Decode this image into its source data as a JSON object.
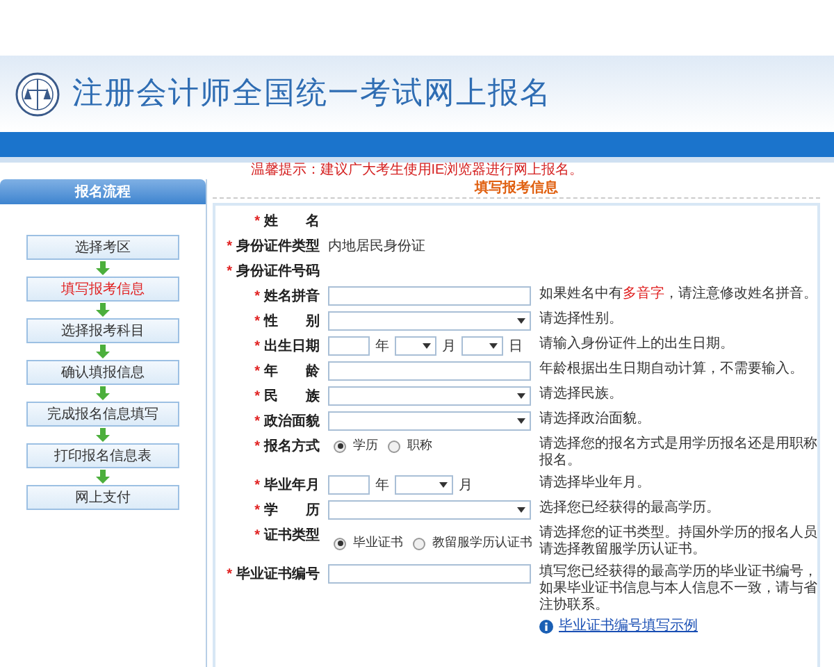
{
  "header": {
    "title": "注册会计师全国统一考试网上报名"
  },
  "notice": "温馨提示：建议广大考生使用IE浏览器进行网上报名。",
  "sidebar": {
    "title": "报名流程",
    "steps": [
      {
        "label": "选择考区",
        "selected": false
      },
      {
        "label": "填写报考信息",
        "selected": true
      },
      {
        "label": "选择报考科目",
        "selected": false
      },
      {
        "label": "确认填报信息",
        "selected": false
      },
      {
        "label": "完成报名信息填写",
        "selected": false
      },
      {
        "label": "打印报名信息表",
        "selected": false
      },
      {
        "label": "网上支付",
        "selected": false
      }
    ]
  },
  "form": {
    "title": "填写报考信息",
    "rows": [
      {
        "kind": "blank",
        "mark": "*",
        "label": "姓　　名"
      },
      {
        "kind": "text",
        "mark": "*",
        "label": "身份证件类型",
        "value": "内地居民身份证"
      },
      {
        "kind": "blank",
        "mark": "*",
        "label": "身份证件号码"
      },
      {
        "kind": "input",
        "mark": "*",
        "label": "姓名拼音",
        "hint": [
          {
            "text": "如果姓名中有",
            "highlight": false
          },
          {
            "text": "多音字",
            "highlight": true
          },
          {
            "text": "，请注意修改姓名拼音。",
            "highlight": false
          }
        ]
      },
      {
        "kind": "select",
        "mark": "*",
        "label": "性　　别",
        "hint": [
          {
            "text": "请选择性别。",
            "highlight": false
          }
        ]
      },
      {
        "kind": "date",
        "mark": "*",
        "label": "出生日期",
        "units": [
          "年",
          "月",
          "日"
        ],
        "hint": [
          {
            "text": "请输入身份证件上的出生日期。",
            "highlight": false
          }
        ]
      },
      {
        "kind": "input",
        "mark": "*",
        "label": "年　　龄",
        "hint": [
          {
            "text": "年龄根据出生日期自动计算，不需要输入。",
            "highlight": false
          }
        ]
      },
      {
        "kind": "select",
        "mark": "*",
        "label": "民　　族",
        "hint": [
          {
            "text": "请选择民族。",
            "highlight": false
          }
        ]
      },
      {
        "kind": "select",
        "mark": "*",
        "label": "政治面貌",
        "hint": [
          {
            "text": "请选择政治面貌。",
            "highlight": false
          }
        ]
      },
      {
        "kind": "radio",
        "mark": "*",
        "label": "报名方式",
        "options": [
          {
            "label": "学历",
            "selected": true
          },
          {
            "label": "职称",
            "selected": false
          }
        ],
        "hint": [
          {
            "text": "请选择您的报名方式是用学历报名还是用职称报名。",
            "highlight": false
          }
        ]
      },
      {
        "kind": "month",
        "mark": "*",
        "label": "毕业年月",
        "units": [
          "年",
          "月"
        ],
        "hint": [
          {
            "text": "请选择毕业年月。",
            "highlight": false
          }
        ]
      },
      {
        "kind": "select",
        "mark": "*",
        "label": "学　　历",
        "hint": [
          {
            "text": "选择您已经获得的最高学历。",
            "highlight": false
          }
        ]
      },
      {
        "kind": "radio",
        "mark": "*",
        "label": "证书类型",
        "options": [
          {
            "label": "毕业证书",
            "selected": true
          },
          {
            "label": "教留服学历认证书",
            "selected": false
          }
        ],
        "hint": [
          {
            "text": "请选择您的证书类型。持国外学历的报名人员请选择教留服学历认证书。",
            "highlight": false
          }
        ]
      },
      {
        "kind": "input",
        "mark": "*",
        "label": "毕业证书编号",
        "hint": [
          {
            "text": "填写您已经获得的最高学历的毕业证书编号，如果毕业证书信息与本人信息不一致，请与省注协联系。",
            "highlight": false
          }
        ],
        "link": "毕业证书编号填写示例"
      }
    ]
  }
}
